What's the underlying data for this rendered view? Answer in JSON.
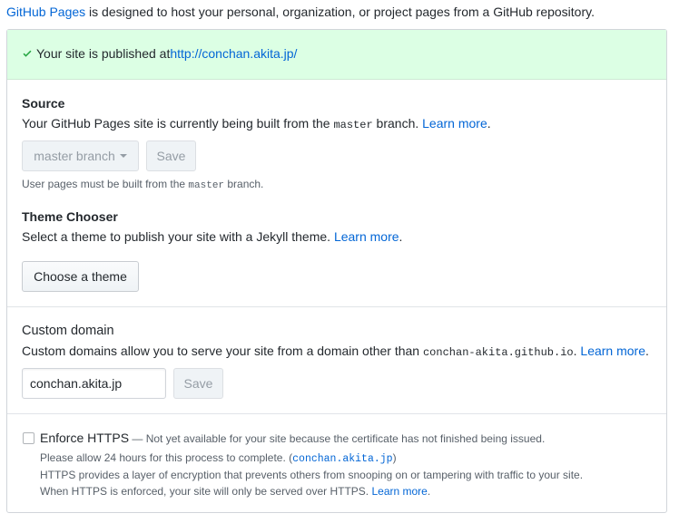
{
  "intro": {
    "link": "GitHub Pages",
    "text": " is designed to host your personal, organization, or project pages from a GitHub repository."
  },
  "flash": {
    "text": "Your site is published at ",
    "url": "http://conchan.akita.jp/"
  },
  "source": {
    "title": "Source",
    "desc_before": "Your GitHub Pages site is currently being built from the ",
    "desc_code": "master",
    "desc_after": " branch. ",
    "learn_more": "Learn more",
    "period": ".",
    "branch_select": "master branch",
    "save": "Save",
    "note_before": "User pages must be built from the ",
    "note_code": "master",
    "note_after": " branch."
  },
  "theme": {
    "title": "Theme Chooser",
    "desc": "Select a theme to publish your site with a Jekyll theme. ",
    "learn_more": "Learn more",
    "period": ".",
    "button": "Choose a theme"
  },
  "domain": {
    "title": "Custom domain",
    "desc": "Custom domains allow you to serve your site from a domain other than ",
    "desc_code": "conchan-akita.github.io",
    "desc_after": ". ",
    "learn_more": "Learn more",
    "period": ".",
    "input_value": "conchan.akita.jp",
    "save": "Save"
  },
  "https": {
    "title": "Enforce HTTPS",
    "dash_note": " — Not yet available for your site because the certificate has not finished being issued.",
    "line2_before": "Please allow 24 hours for this process to complete. (",
    "line2_code": "conchan.akita.jp",
    "line2_after": ")",
    "line3": "HTTPS provides a layer of encryption that prevents others from snooping on or tampering with traffic to your site.",
    "line4": "When HTTPS is enforced, your site will only be served over HTTPS. ",
    "learn_more": "Learn more",
    "period": "."
  },
  "colors": {
    "link": "#0366d6",
    "flash_bg": "#dcffe4",
    "check": "#28a745"
  }
}
